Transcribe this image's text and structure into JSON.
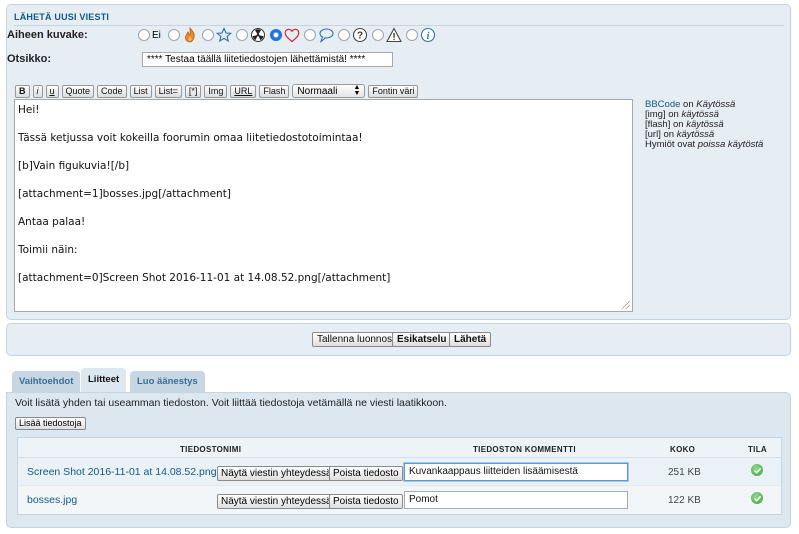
{
  "post_form": {
    "section_title": "LÄHETÄ UUSI VIESTI",
    "icon_label": "Aiheen kuvake:",
    "icon_options": [
      {
        "label": "Ei",
        "icon": "none",
        "selected": false
      },
      {
        "label": "",
        "icon": "fire-icon",
        "selected": false
      },
      {
        "label": "",
        "icon": "star-icon",
        "selected": false
      },
      {
        "label": "",
        "icon": "radioactive-icon",
        "selected": false
      },
      {
        "label": "",
        "icon": "heart-icon",
        "selected": true
      },
      {
        "label": "",
        "icon": "speech-bubble-icon",
        "selected": false
      },
      {
        "label": "",
        "icon": "question-icon",
        "selected": false
      },
      {
        "label": "",
        "icon": "warning-icon",
        "selected": false
      },
      {
        "label": "",
        "icon": "info-icon",
        "selected": false
      }
    ],
    "subject_label": "Otsikko:",
    "subject_value": "**** Testaa täällä liitetiedostojen lähettämistä! ****",
    "toolbar": {
      "bold": "B",
      "italic": "i",
      "underline": "u",
      "quote": "Quote",
      "code": "Code",
      "list": "List",
      "list_eq": "List=",
      "list_item": "[*]",
      "img": "Img",
      "url": "URL",
      "flash": "Flash",
      "size_select": "Normaali",
      "font_color": "Fontin väri"
    },
    "editor_lines": [
      "Hei!",
      "Tässä ketjussa voit kokeilla foorumin omaa liitetiedostotoimintaa!",
      "[b]Vain figukuvia![/b]",
      "[attachment=1]bosses.jpg[/attachment]",
      "Antaa palaa!",
      "Toimii näin:",
      "[attachment=0]Screen Shot 2016-11-01 at 14.08.52.png[/attachment]"
    ],
    "help": {
      "bbcode_link": "BBCode",
      "bbcode_on": "on",
      "bbcode_state": "Käytössä",
      "img_tag": "[img]",
      "img_on": "on",
      "img_state": "käytössä",
      "flash_tag": "[flash]",
      "flash_on": "on",
      "flash_state": "käytössä",
      "url_tag": "[url]",
      "url_on": "on",
      "url_state": "käytössä",
      "smilies_text": "Hymiöt ovat",
      "smilies_state": "poissa käytöstä"
    }
  },
  "actions": {
    "save_draft": "Tallenna luonnos",
    "preview": "Esikatselu",
    "submit": "Lähetä"
  },
  "tabs": [
    {
      "label": "Vaihtoehdot",
      "active": false
    },
    {
      "label": "Liitteet",
      "active": true
    },
    {
      "label": "Luo äänestys",
      "active": false
    }
  ],
  "attachments": {
    "info": "Voit lisätä yhden tai useamman tiedoston. Voit liittää tiedostoja vetämällä ne viesti laatikkoon.",
    "add_button": "Lisää tiedostoja",
    "headers": {
      "filename": "TIEDOSTONIMI",
      "comment": "TIEDOSTON KOMMENTTI",
      "size": "KOKO",
      "status": "TILA"
    },
    "files": [
      {
        "name": "Screen Shot 2016-11-01 at 14.08.52.png",
        "show_inline": "Näytä viestin yhteydessä",
        "delete": "Poista tiedosto",
        "comment": "Kuvankaappaus liitteiden lisäämisestä",
        "size": "251 KB",
        "status": "ok"
      },
      {
        "name": "bosses.jpg",
        "show_inline": "Näytä viestin yhteydessä",
        "delete": "Poista tiedosto",
        "comment": "Pomot",
        "size": "122 KB",
        "status": "ok"
      }
    ]
  },
  "colors": {
    "panel_bg": "#e6edf3",
    "link": "#125a8c",
    "status_ok": "#3aa43a"
  }
}
